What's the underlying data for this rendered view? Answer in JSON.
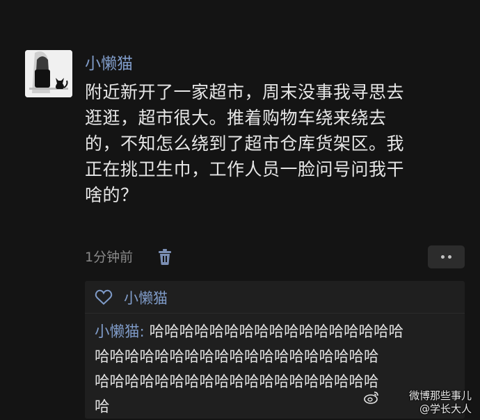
{
  "post": {
    "author": "小懒猫",
    "lines": [
      "附近新开了一家超市，周末没事我寻思去",
      "逛逛，超市很大。推着购物车绕来绕去",
      "的，不知怎么绕到了超市仓库货架区。我",
      "正在挑卫生巾，工作人员一脸问号问我干",
      "啥的？"
    ],
    "time": "1分钟前"
  },
  "comments": {
    "liker": "小懒猫",
    "commenter": "小懒猫",
    "separator": ": ",
    "lines": [
      "哈哈哈哈哈哈哈哈哈哈哈哈哈哈哈哈哈",
      "哈哈哈哈哈哈哈哈哈哈哈哈哈哈哈哈哈哈哈",
      "哈哈哈哈哈哈哈哈哈哈哈哈哈哈哈哈哈哈哈",
      "哈"
    ]
  },
  "watermark": {
    "line1": "微博那些事儿",
    "line2": "@学长大人"
  },
  "icons": {
    "avatar": "avatar-image",
    "delete": "trash-icon",
    "more": "more-dots-icon",
    "like": "heart-icon",
    "logo": "weibo-logo-icon"
  },
  "colors": {
    "background": "#141414",
    "name_link": "#7f9bc8",
    "text": "#e7e7e7",
    "meta": "#8a8a8a",
    "comment_panel": "#1f1f1f"
  }
}
